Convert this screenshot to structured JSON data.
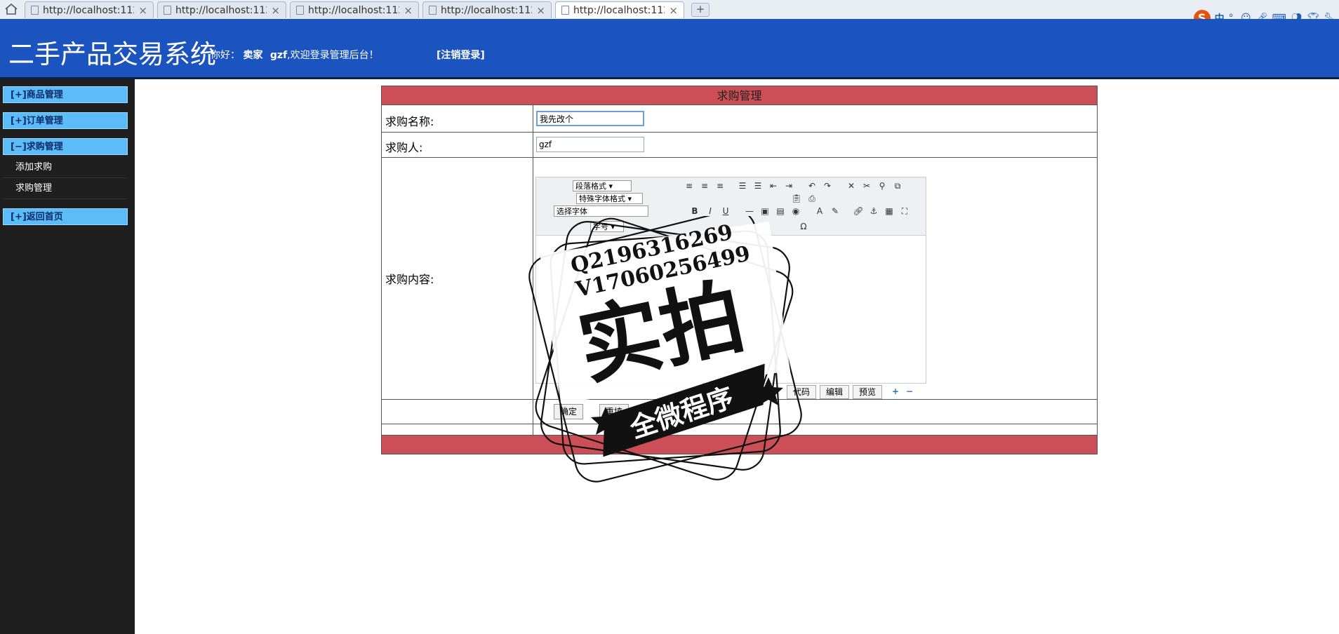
{
  "browser": {
    "tabs": [
      {
        "label": "http://localhost:11283/"
      },
      {
        "label": "http://localhost:11283/"
      },
      {
        "label": "http://localhost:11283/"
      },
      {
        "label": "http://localhost:11283/"
      },
      {
        "label": "http://localhost:11283/"
      }
    ],
    "new_tab": "+",
    "close": "×",
    "ime": {
      "logo": "S",
      "lang": "中",
      "punct": "°,"
    }
  },
  "header": {
    "title": "二手产品交易系统",
    "greeting_prefix": "你好：",
    "role": "卖家",
    "username": "gzf",
    "greeting_suffix": ",欢迎登录管理后台！",
    "logout": "[注销登录]"
  },
  "sidebar": {
    "items": [
      {
        "label": "[+]商品管理"
      },
      {
        "label": "[+]订单管理"
      },
      {
        "label": "[−]求购管理",
        "children": [
          {
            "label": "添加求购"
          },
          {
            "label": "求购管理"
          }
        ]
      },
      {
        "label": "[+]返回首页"
      }
    ]
  },
  "form": {
    "caption": "求购管理",
    "name_label": "求购名称:",
    "name_value": "我先改个",
    "person_label": "求购人:",
    "person_value": "gzf",
    "content_label": "求购内容:",
    "toolbar": {
      "paragraph": "段落格式",
      "special_font": "特殊字体格式",
      "font": "选择字体",
      "size": "字号",
      "bold": "B",
      "italic": "I",
      "underline": "U"
    },
    "editor_tabs": [
      "代码",
      "编辑",
      "预览"
    ],
    "submit": "确定",
    "reset": "重填"
  },
  "watermark": {
    "line1": "Q2196316269",
    "line2": "V17060256499",
    "main": "实拍",
    "banner": "全微程序"
  }
}
